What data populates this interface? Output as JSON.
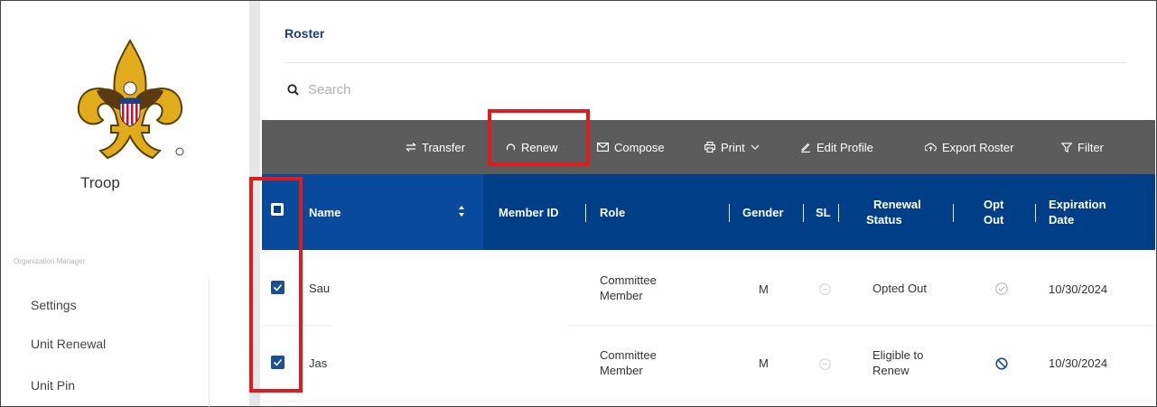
{
  "sidebar": {
    "unit_name": "Troop",
    "section_label": "Organization Manager",
    "items": [
      {
        "label": "Settings"
      },
      {
        "label": "Unit Renewal"
      },
      {
        "label": "Unit Pin"
      }
    ]
  },
  "main": {
    "title": "Roster",
    "search": {
      "placeholder": "Search"
    },
    "toolbar": {
      "transfer": "Transfer",
      "renew": "Renew",
      "compose": "Compose",
      "print": "Print",
      "edit_profile": "Edit Profile",
      "export_roster": "Export Roster",
      "filter": "Filter"
    },
    "table": {
      "columns": {
        "name": "Name",
        "member_id": "Member ID",
        "role": "Role",
        "gender": "Gender",
        "sl": "SL",
        "renewal_status_1": "Renewal",
        "renewal_status_2": "Status",
        "opt_out_1": "Opt",
        "opt_out_2": "Out",
        "expiration_1": "Expiration",
        "expiration_2": "Date"
      },
      "rows": [
        {
          "name": "Sau",
          "role_1": "Committee",
          "role_2": "Member",
          "gender": "M",
          "status_1": "Opted Out",
          "status_2": "",
          "expiration": "10/30/2024",
          "opt_out_icon": "check-circle-icon"
        },
        {
          "name": "Jas",
          "role_1": "Committee",
          "role_2": "Member",
          "gender": "M",
          "status_1": "Eligible to",
          "status_2": "Renew",
          "expiration": "10/30/2024",
          "opt_out_icon": "prohibited-icon"
        }
      ]
    }
  },
  "colors": {
    "header_blue": "#003f87",
    "toolbar_gray": "#5c5c5c",
    "highlight_red": "#e01b1b",
    "title_blue": "#1f3c73"
  }
}
